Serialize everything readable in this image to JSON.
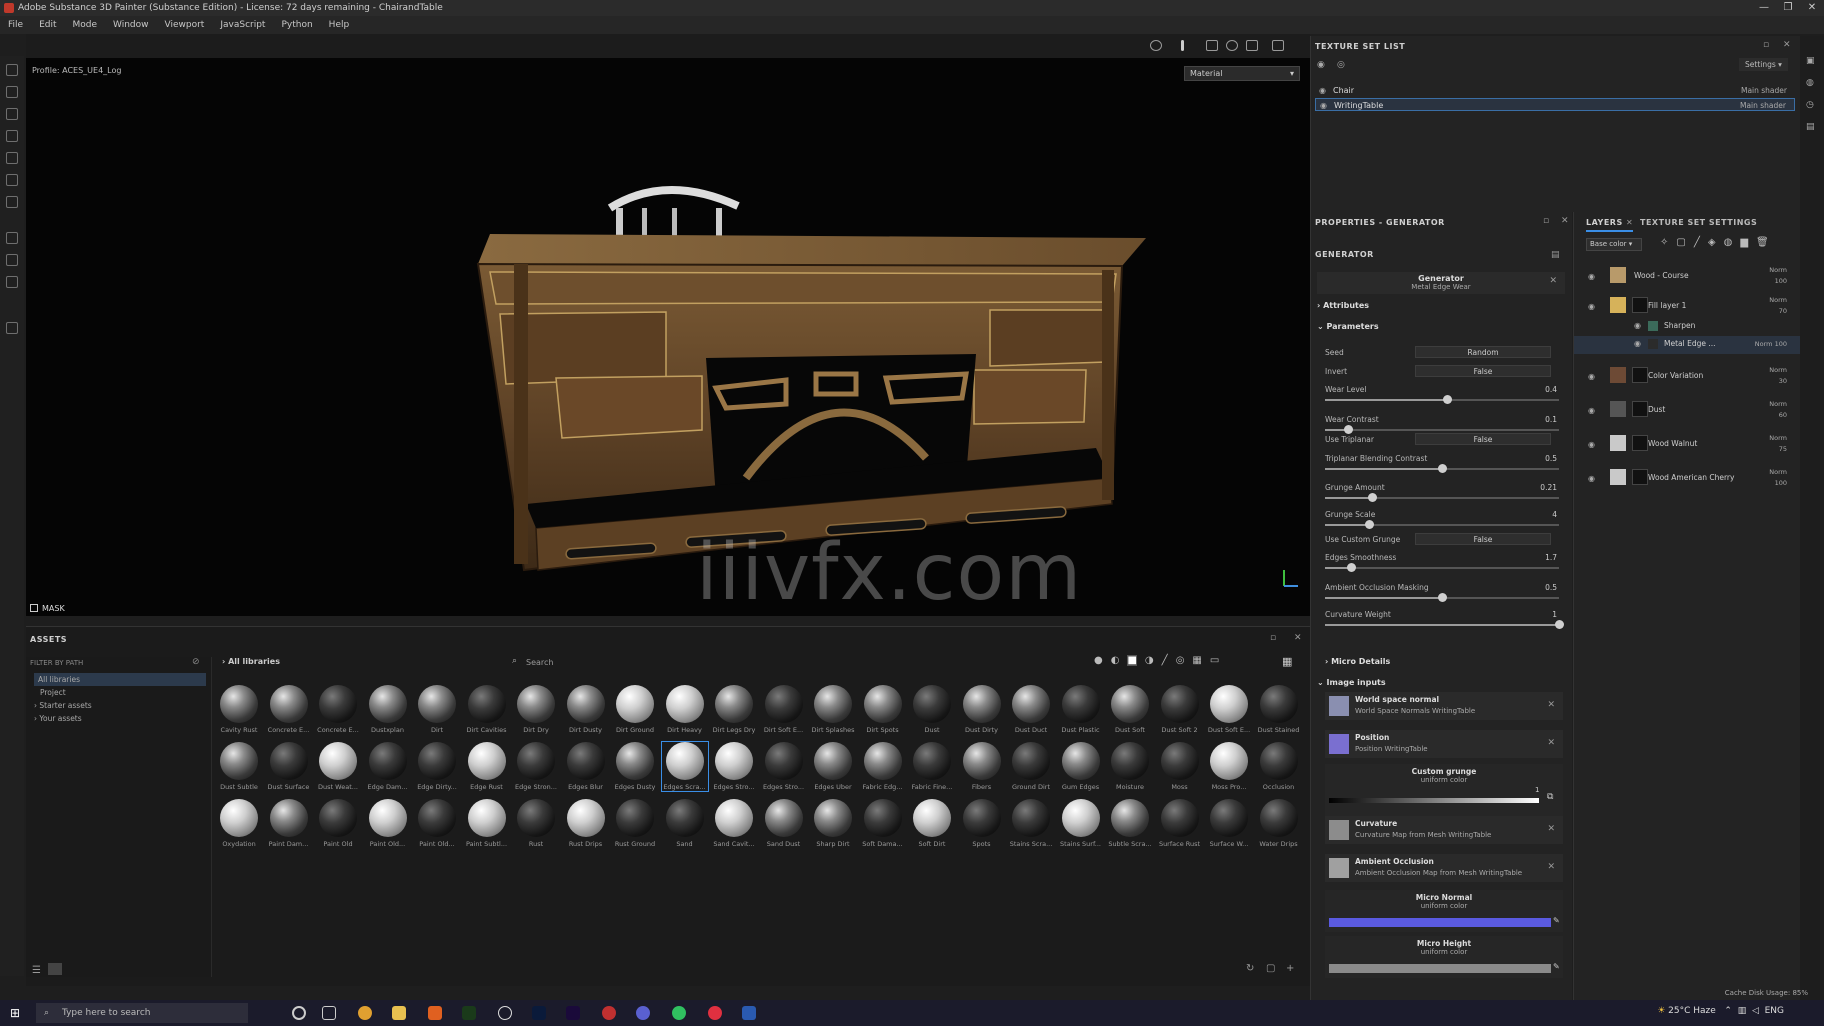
{
  "window": {
    "title": "Adobe Substance 3D Painter (Substance Edition) - License: 72 days remaining - ChairandTable",
    "controls": [
      "—",
      "❐",
      "✕"
    ]
  },
  "menu": [
    "File",
    "Edit",
    "Mode",
    "Window",
    "Viewport",
    "JavaScript",
    "Python",
    "Help"
  ],
  "viewport": {
    "profile": "Profile: ACES_UE4_Log",
    "material_dropdown": "Material",
    "mask_label": "MASK",
    "watermark": "iiivfx.com"
  },
  "assets": {
    "title": "ASSETS",
    "filter_label": "FILTER BY PATH",
    "tree": [
      "All libraries",
      "Project",
      "Starter assets",
      "Your assets"
    ],
    "breadcrumb": "All libraries",
    "search_placeholder": "Search",
    "rows": [
      [
        "Cavity Rust",
        "Concrete E...",
        "Concrete E...",
        "Dustxplan",
        "Dirt",
        "Dirt Cavities",
        "Dirt Dry",
        "Dirt Dusty",
        "Dirt Ground",
        "Dirt Heavy",
        "Dirt Legs Dry",
        "Dirt Soft E...",
        "Dirt Splashes",
        "Dirt Spots",
        "Dust",
        "Dust Dirty",
        "Dust Duct",
        "Dust Plastic",
        "Dust Soft",
        "Dust Soft 2",
        "Dust Soft E...",
        "Dust Stained"
      ],
      [
        "Dust Subtle",
        "Dust Surface",
        "Dust Weat...",
        "Edge Dam...",
        "Edge Dirty...",
        "Edge Rust",
        "Edge Stron...",
        "Edges Blur",
        "Edges Dusty",
        "Edges Scra...",
        "Edges Stro...",
        "Edges Stro...",
        "Edges Uber",
        "Fabric Edg...",
        "Fabric Fine...",
        "Fibers",
        "Ground Dirt",
        "Gum Edges",
        "Moisture",
        "Moss",
        "Moss Pro...",
        "Occlusion"
      ],
      [
        "Oxydation",
        "Paint Dam...",
        "Paint Old",
        "Paint Old...",
        "Paint Old...",
        "Paint Subtl...",
        "Rust",
        "Rust Drips",
        "Rust Ground",
        "Sand",
        "Sand Cavit...",
        "Sand Dust",
        "Sharp Dirt",
        "Soft Dama...",
        "Soft Dirt",
        "Spots",
        "Stains Scra...",
        "Stains Surf...",
        "Subtle Scra...",
        "Surface Rust",
        "Surface W...",
        "Water Drips"
      ]
    ]
  },
  "texture_set_list": {
    "title": "TEXTURE SET LIST",
    "settings": "Settings",
    "items": [
      {
        "name": "Chair",
        "shader": "Main shader"
      },
      {
        "name": "WritingTable",
        "shader": "Main shader"
      }
    ]
  },
  "properties": {
    "title": "PROPERTIES - GENERATOR",
    "section": "GENERATOR",
    "generator_name": "Generator",
    "generator_sub": "Metal Edge Wear",
    "attributes": "Attributes",
    "parameters": "Parameters",
    "params": [
      {
        "label": "Seed",
        "type": "dropdown",
        "value": "Random"
      },
      {
        "label": "Invert",
        "type": "dropdown",
        "value": "False"
      },
      {
        "label": "Wear Level",
        "type": "slider",
        "value": "0.4",
        "fraction": 0.52
      },
      {
        "label": "Wear Contrast",
        "type": "slider",
        "value": "0.1",
        "fraction": 0.1
      },
      {
        "label": "Use Triplanar",
        "type": "dropdown",
        "value": "False"
      },
      {
        "label": "Triplanar Blending Contrast",
        "type": "slider",
        "value": "0.5",
        "fraction": 0.5
      },
      {
        "label": "Grunge Amount",
        "type": "slider",
        "value": "0.21",
        "fraction": 0.2
      },
      {
        "label": "Grunge Scale",
        "type": "slider",
        "value": "4",
        "fraction": 0.19
      },
      {
        "label": "Use Custom Grunge",
        "type": "dropdown",
        "value": "False"
      },
      {
        "label": "Edges Smoothness",
        "type": "slider",
        "value": "1.7",
        "fraction": 0.11
      },
      {
        "label": "Ambient Occlusion Masking",
        "type": "slider",
        "value": "0.5",
        "fraction": 0.5
      },
      {
        "label": "Curvature Weight",
        "type": "slider",
        "value": "1",
        "fraction": 1.0
      }
    ],
    "micro_details": "Micro Details",
    "image_inputs": "Image inputs",
    "inputs": [
      {
        "title": "World space normal",
        "sub": "World Space Normals WritingTable",
        "color": "#8a8fb0"
      },
      {
        "title": "Position",
        "sub": "Position WritingTable",
        "color": "#7a6fd0"
      }
    ],
    "custom_grunge": {
      "title": "Custom grunge",
      "sub": "uniform color",
      "value": "1"
    },
    "inputs2": [
      {
        "title": "Curvature",
        "sub": "Curvature Map from Mesh WritingTable",
        "color": "#8c8c8c"
      },
      {
        "title": "Ambient Occlusion",
        "sub": "Ambient Occlusion Map from Mesh WritingTable",
        "color": "#a0a0a0"
      }
    ],
    "micro_normal": {
      "title": "Micro Normal",
      "sub": "uniform color",
      "color": "#5a5ae0"
    },
    "micro_height": {
      "title": "Micro Height",
      "sub": "uniform color",
      "color": "#8a8a8a"
    }
  },
  "layers": {
    "tab_layers": "LAYERS",
    "tab_tss": "TEXTURE SET SETTINGS",
    "channel": "Base color",
    "items": [
      {
        "name": "Wood - Course",
        "blend": "Norm",
        "opacity": "100",
        "color": "#b89a6a",
        "indent": 0
      },
      {
        "name": "Fill layer 1",
        "blend": "Norm",
        "opacity": "70",
        "color": "#d6b25a",
        "indent": 0
      },
      {
        "name": "Sharpen",
        "blend": "",
        "opacity": "",
        "color": "#3b6a5a",
        "indent": 1
      },
      {
        "name": "Metal Edge ...",
        "blend": "Norm",
        "opacity": "100",
        "color": "#2b2b2b",
        "indent": 1
      },
      {
        "name": "Color Variation",
        "blend": "Norm",
        "opacity": "30",
        "color": "#6d4a35",
        "indent": 0
      },
      {
        "name": "Dust",
        "blend": "Norm",
        "opacity": "60",
        "color": "#555",
        "indent": 0
      },
      {
        "name": "Wood Walnut",
        "blend": "Norm",
        "opacity": "75",
        "color": "#c9c9c9",
        "indent": 0
      },
      {
        "name": "Wood American Cherry",
        "blend": "Norm",
        "opacity": "100",
        "color": "#c9c9c9",
        "indent": 0
      }
    ]
  },
  "status": {
    "cache": "Cache Disk Usage:",
    "cache_value": "85%"
  },
  "taskbar": {
    "search": "Type here to search",
    "weather": "25°C Haze",
    "lang": "ENG"
  }
}
